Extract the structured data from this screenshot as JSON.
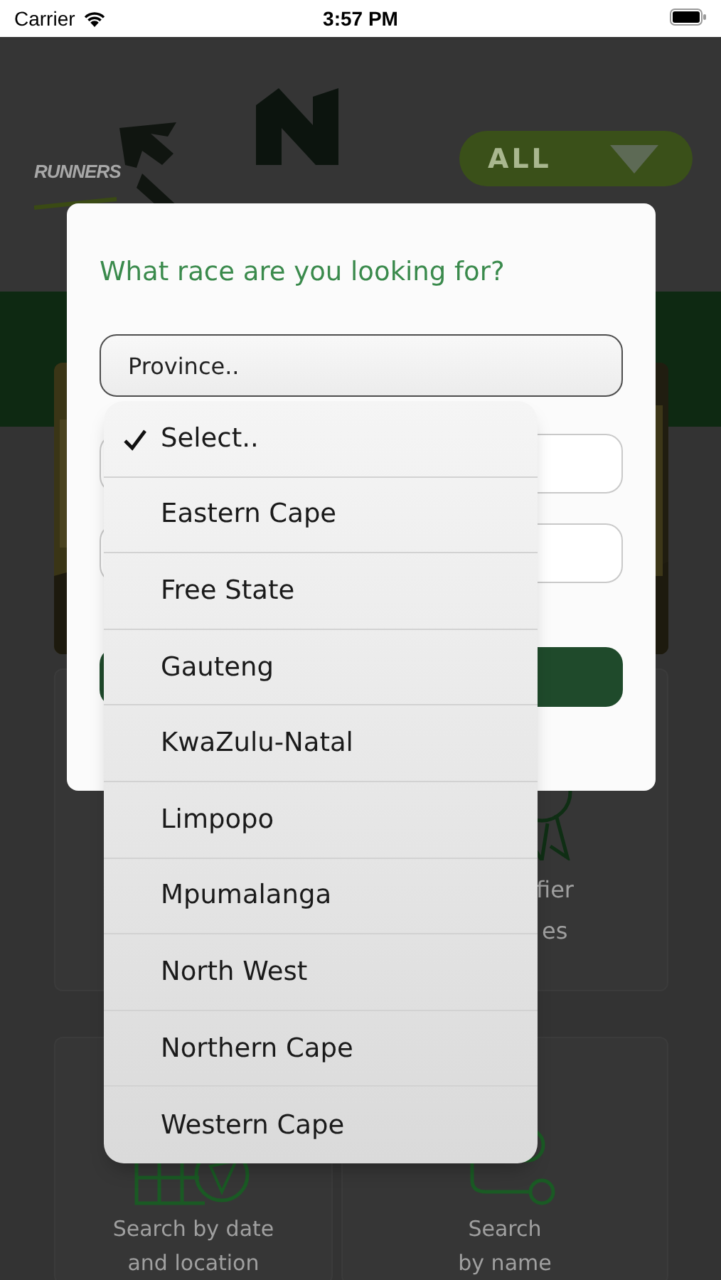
{
  "status_bar": {
    "carrier": "Carrier",
    "time": "3:57 PM"
  },
  "header": {
    "logo_text": "RUNNERS",
    "filter": {
      "value": "ALL"
    }
  },
  "cards": [
    {
      "kind": "qualifier",
      "line_1": "fier",
      "line_2": "es"
    },
    {
      "kind": "date",
      "line_1": "Search by date",
      "line_2": "and location"
    },
    {
      "kind": "name",
      "line_1": "Search",
      "line_2": "by name"
    }
  ],
  "dialog": {
    "title": "What race are you looking for?",
    "province_field": {
      "value": "Province.."
    }
  },
  "dropdown": {
    "options": [
      {
        "label": "Select..",
        "selected": true
      },
      {
        "label": "Eastern Cape",
        "selected": false
      },
      {
        "label": "Free State",
        "selected": false
      },
      {
        "label": "Gauteng",
        "selected": false
      },
      {
        "label": "KwaZulu-Natal",
        "selected": false
      },
      {
        "label": "Limpopo",
        "selected": false
      },
      {
        "label": "Mpumalanga",
        "selected": false
      },
      {
        "label": "North West",
        "selected": false
      },
      {
        "label": "Northern Cape",
        "selected": false
      },
      {
        "label": "Western Cape",
        "selected": false
      }
    ]
  }
}
